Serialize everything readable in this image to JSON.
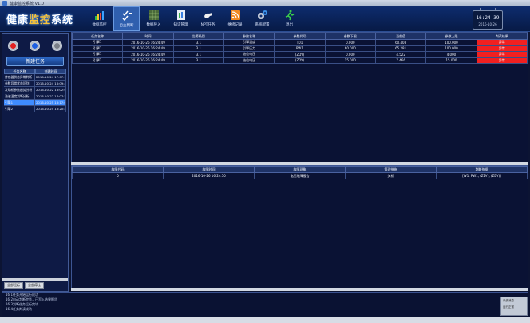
{
  "window": {
    "title": "健康监控系统 V1.0"
  },
  "brand": {
    "part1": "健康",
    "accent": "监控",
    "part2": "系统"
  },
  "toolbar": [
    {
      "label": "数据监控",
      "icon": "bar-chart-icon",
      "active": false
    },
    {
      "label": "自主判断",
      "icon": "checklist-icon",
      "active": true
    },
    {
      "label": "数据导入",
      "icon": "grid-data-icon",
      "active": false
    },
    {
      "label": "知识管理",
      "icon": "document-icon",
      "active": false
    },
    {
      "label": "NPT任务",
      "icon": "hand-icon",
      "active": false
    },
    {
      "label": "维修记录",
      "icon": "rss-log-icon",
      "active": false
    },
    {
      "label": "系统配置",
      "icon": "gears-icon",
      "active": false
    },
    {
      "label": "退出",
      "icon": "running-man-icon",
      "active": false
    }
  ],
  "clock": {
    "time": "16:24:39",
    "date": "2016-10-26"
  },
  "left": {
    "new_task": "新建任务",
    "headers": [
      "任务名称",
      "创建时间"
    ],
    "tasks": [
      {
        "name": "传感器状态异常判断",
        "time": "2016-10-24 17:07:19"
      },
      {
        "name": "参数异常状态识别",
        "time": "2016-10-24 16:09:46"
      },
      {
        "name": "发动机参数趋势分析",
        "time": "2016-10-22 16:02:01"
      },
      {
        "name": "油液温度判断分析",
        "time": "2016-10-22 17:07:29"
      },
      {
        "name": "引擎1",
        "time": "2016-10-25 16:17:06"
      },
      {
        "name": "引擎2",
        "time": "2016-10-25 16:20:47"
      }
    ],
    "buttons": [
      "全部运行",
      "全部停止"
    ]
  },
  "upper": {
    "headers": [
      "任务名称",
      "时间",
      "告警级别",
      "参数名称",
      "参数代号",
      "参数下限",
      "当前值",
      "参数上限",
      "判读结果"
    ],
    "rows": [
      [
        "引擎1",
        "2016-10-26 16:24:49",
        "3.1",
        "引擎温度",
        "T01",
        "0.000",
        "60.408",
        "100.000",
        "异常"
      ],
      [
        "引擎1",
        "2016-10-26 16:24:49",
        "3.1",
        "引擎压力",
        "PW1",
        "60.000",
        "65.281",
        "100.000",
        "异常"
      ],
      [
        "引擎1",
        "2016-10-26 16:24:49",
        "3.1",
        "油位电压",
        "(ZDY)",
        "0.000",
        "4.522",
        "4.000",
        "异常"
      ],
      [
        "引擎2",
        "2016-10-26 16:24:49",
        "3.1",
        "油位电压",
        "(ZDY)",
        "15.000",
        "7.466",
        "15.000",
        "异常"
      ]
    ]
  },
  "lower": {
    "headers": [
      "故障代码",
      "故障时间",
      "故障现象",
      "管理措施",
      "判断依据"
    ],
    "rows": [
      [
        "0",
        "2016-10-26 16:24:50",
        "电压故障报告",
        "关机",
        "[W1, PW1, (ZDY), (ZDY)]"
      ]
    ]
  },
  "log": [
    "16:1任务开始运行成功",
    "16:2自动判断完毕，已写入结果报告",
    "16:3判断任务运行完毕",
    "16:4任务判读成功"
  ],
  "corner": {
    "line1": "系统消息",
    "line2": "运行正常"
  },
  "colors": {
    "alarm": "#f12020",
    "selected": "#3f8cff",
    "accent": "#f6c23a"
  }
}
